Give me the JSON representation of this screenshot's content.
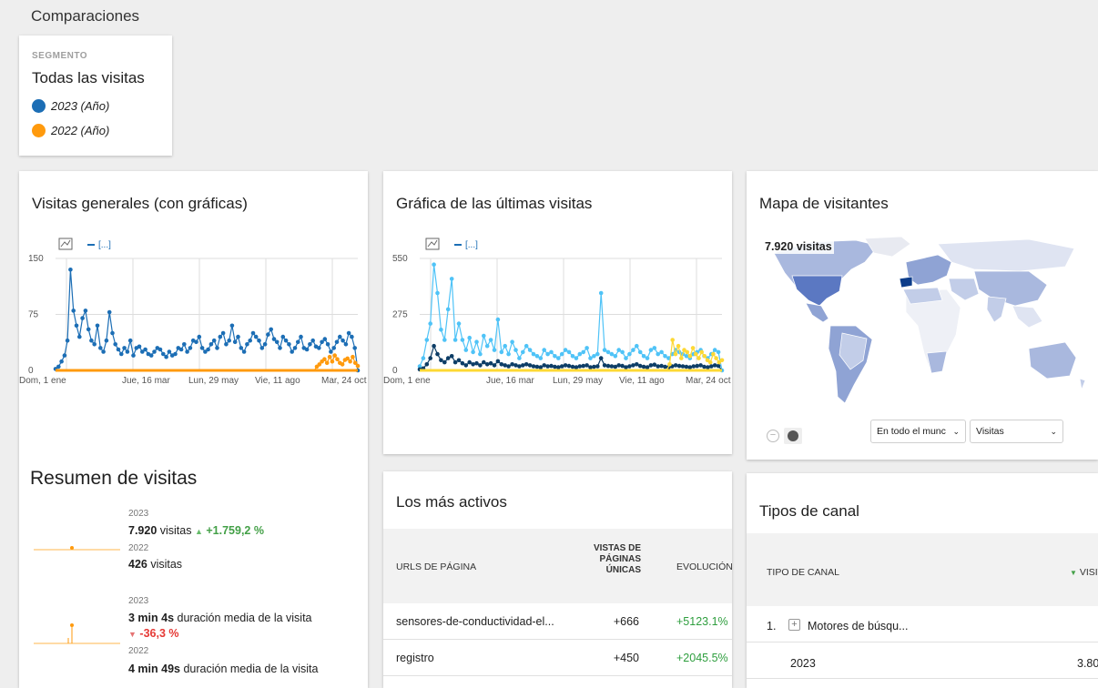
{
  "page": {
    "title": "Comparaciones"
  },
  "segment": {
    "label": "SEGMENTO",
    "name": "Todas las visitas",
    "periods": [
      {
        "label": "2023 (Año)",
        "color": "#1c6eb5"
      },
      {
        "label": "2022 (Año)",
        "color": "#ff9a0d"
      }
    ]
  },
  "visits_overview": {
    "title": "Visitas generales (con gráficas)",
    "legend_text": "[...]",
    "chart_data": {
      "type": "line",
      "y_ticks": [
        "150",
        "75",
        "0"
      ],
      "ylim": [
        0,
        150
      ],
      "x_ticks": [
        "Dom, 1 ene",
        "Jue, 16 mar",
        "Lun, 29 may",
        "Vie, 11 ago",
        "Mar, 24 oct"
      ],
      "series": [
        {
          "color": "#1c6eb5",
          "values": [
            2,
            5,
            12,
            20,
            40,
            135,
            80,
            60,
            45,
            70,
            80,
            55,
            40,
            35,
            60,
            30,
            25,
            40,
            78,
            50,
            35,
            28,
            22,
            30,
            25,
            40,
            20,
            30,
            32,
            25,
            28,
            22,
            20,
            25,
            30,
            28,
            22,
            18,
            25,
            20,
            22,
            30,
            28,
            35,
            25,
            30,
            40,
            38,
            45,
            30,
            25,
            28,
            35,
            40,
            30,
            45,
            50,
            35,
            40,
            60,
            38,
            45,
            30,
            25,
            35,
            40,
            50,
            45,
            40,
            30,
            35,
            48,
            55,
            42,
            38,
            30,
            45,
            40,
            35,
            25,
            30,
            38,
            45,
            30,
            28,
            35,
            40,
            32,
            30,
            38,
            42,
            35,
            25,
            30,
            38,
            45,
            40,
            35,
            50,
            45,
            30,
            0
          ]
        },
        {
          "color": "#ff9a0d",
          "values": [
            0,
            0,
            0,
            0,
            0,
            0,
            0,
            0,
            0,
            0,
            0,
            0,
            0,
            0,
            0,
            0,
            0,
            0,
            0,
            0,
            0,
            0,
            0,
            0,
            0,
            0,
            0,
            0,
            0,
            0,
            0,
            0,
            0,
            0,
            0,
            0,
            0,
            0,
            0,
            0,
            0,
            0,
            0,
            0,
            0,
            0,
            0,
            0,
            0,
            0,
            0,
            0,
            0,
            0,
            0,
            0,
            0,
            0,
            0,
            0,
            0,
            0,
            0,
            0,
            0,
            0,
            0,
            0,
            0,
            0,
            0,
            0,
            0,
            0,
            0,
            0,
            0,
            0,
            0,
            0,
            0,
            0,
            0,
            0,
            0,
            0,
            0,
            0,
            0,
            0,
            0,
            0,
            0,
            0,
            0,
            0,
            0,
            0,
            0,
            0,
            0,
            0,
            5,
            8,
            12,
            15,
            10,
            18,
            12,
            20,
            15,
            10,
            8,
            14,
            16,
            12,
            18,
            10,
            6
          ]
        }
      ]
    }
  },
  "last_visits": {
    "title": "Gráfica de las últimas visitas",
    "legend_text": "[...]",
    "chart_data": {
      "type": "line",
      "y_ticks": [
        "550",
        "275",
        "0"
      ],
      "ylim": [
        0,
        550
      ],
      "x_ticks": [
        "Dom, 1 ene",
        "Jue, 16 mar",
        "Lun, 29 may",
        "Vie, 11 ago",
        "Mar, 24 oct"
      ],
      "series": [
        {
          "color": "#4fc3f7",
          "values": [
            20,
            60,
            150,
            230,
            520,
            380,
            200,
            150,
            300,
            450,
            150,
            230,
            150,
            100,
            160,
            90,
            140,
            80,
            170,
            120,
            150,
            100,
            250,
            90,
            120,
            80,
            140,
            100,
            60,
            90,
            120,
            100,
            80,
            70,
            60,
            100,
            80,
            90,
            70,
            60,
            80,
            100,
            90,
            70,
            60,
            80,
            90,
            110,
            60,
            70,
            80,
            380,
            100,
            90,
            80,
            70,
            100,
            90,
            60,
            80,
            100,
            120,
            90,
            70,
            60,
            100,
            110,
            80,
            90,
            70,
            60,
            80,
            100,
            90,
            80,
            70,
            60,
            80,
            90,
            100,
            70,
            60,
            80,
            100,
            90,
            0
          ]
        },
        {
          "color": "#0d3d66",
          "values": [
            5,
            10,
            30,
            60,
            120,
            80,
            50,
            40,
            60,
            70,
            40,
            50,
            35,
            25,
            40,
            30,
            35,
            25,
            40,
            30,
            35,
            25,
            45,
            30,
            25,
            20,
            30,
            25,
            20,
            25,
            30,
            25,
            20,
            18,
            15,
            25,
            20,
            22,
            18,
            15,
            20,
            25,
            22,
            18,
            15,
            20,
            22,
            25,
            15,
            18,
            20,
            60,
            25,
            22,
            20,
            18,
            25,
            22,
            15,
            20,
            25,
            30,
            22,
            18,
            15,
            25,
            28,
            20,
            22,
            18,
            15,
            20,
            25,
            22,
            20,
            18,
            15,
            20,
            22,
            25,
            18,
            15,
            20,
            25,
            22,
            0
          ]
        },
        {
          "color": "#fdd835",
          "values": [
            0,
            0,
            0,
            0,
            0,
            0,
            0,
            0,
            0,
            0,
            0,
            0,
            0,
            0,
            0,
            0,
            0,
            0,
            0,
            0,
            0,
            0,
            0,
            0,
            0,
            0,
            0,
            0,
            0,
            0,
            0,
            0,
            0,
            0,
            0,
            0,
            0,
            0,
            0,
            0,
            0,
            0,
            0,
            0,
            0,
            0,
            0,
            0,
            0,
            0,
            0,
            0,
            0,
            0,
            0,
            0,
            0,
            0,
            0,
            0,
            0,
            0,
            0,
            0,
            0,
            0,
            0,
            0,
            0,
            0,
            0,
            0,
            0,
            0,
            0,
            0,
            0,
            0,
            0,
            0,
            0,
            0,
            0,
            0,
            0,
            0,
            30,
            150,
            80,
            120,
            60,
            100,
            90,
            70,
            110,
            80,
            60,
            90,
            70,
            50,
            40,
            80,
            60,
            40,
            50
          ]
        }
      ]
    }
  },
  "visitor_map": {
    "title": "Mapa de visitantes",
    "overlay": "7.920 visitas",
    "region_select": "En todo el munc",
    "metric_select": "Visitas"
  },
  "summary": {
    "title": "Resumen de visitas",
    "blocks": [
      {
        "year_a": "2023",
        "value_a": "7.920",
        "text_a": " visitas",
        "change": "+1.759,2 %",
        "change_dir": "up",
        "year_b": "2022",
        "value_b": "426",
        "text_b": " visitas"
      },
      {
        "year_a": "2023",
        "value_a": "3 min 4s",
        "text_a": " duración media de la visita",
        "change": "-36,3 %",
        "change_dir": "down",
        "year_b": "2022",
        "value_b": "4 min 49s",
        "text_b": " duración media de la visita"
      }
    ]
  },
  "most_active": {
    "title": "Los más activos",
    "columns": [
      "URLS DE PÁGINA",
      "VISTAS DE PÁGINAS ÚNICAS",
      "EVOLUCIÓN"
    ],
    "rows": [
      {
        "url": "sensores-de-conductividad-el...",
        "views": "+666",
        "evolution": "+5123.1%"
      },
      {
        "url": "registro",
        "views": "+450",
        "evolution": "+2045.5%"
      }
    ]
  },
  "channel_types": {
    "title": "Tipos de canal",
    "columns": [
      "TIPO DE CANAL",
      "VISITAS"
    ],
    "rows": [
      {
        "index": "1.",
        "name": "Motores de búsqu...",
        "value": ""
      },
      {
        "index": "",
        "name": "2023",
        "value": "3.80"
      }
    ]
  }
}
